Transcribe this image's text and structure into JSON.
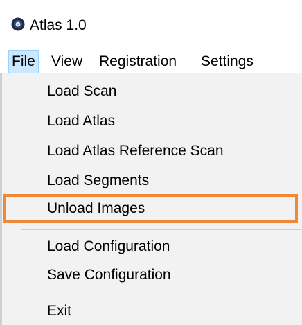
{
  "window": {
    "title": "Atlas 1.0",
    "icon": "app-icon"
  },
  "menubar": {
    "items": [
      "File",
      "View",
      "Registration",
      "Settings"
    ],
    "active": "File"
  },
  "file_menu": {
    "group1": [
      "Load Scan",
      "Load Atlas",
      "Load Atlas Reference Scan",
      "Load Segments",
      "Unload Images"
    ],
    "group2": [
      "Load Configuration",
      "Save Configuration"
    ],
    "group3": [
      "Exit"
    ],
    "highlighted_item": "Unload Images"
  },
  "colors": {
    "highlight_border": "#f0883a",
    "menubar_active_bg": "#cce8ff",
    "dropdown_bg": "#f2f2f2"
  }
}
